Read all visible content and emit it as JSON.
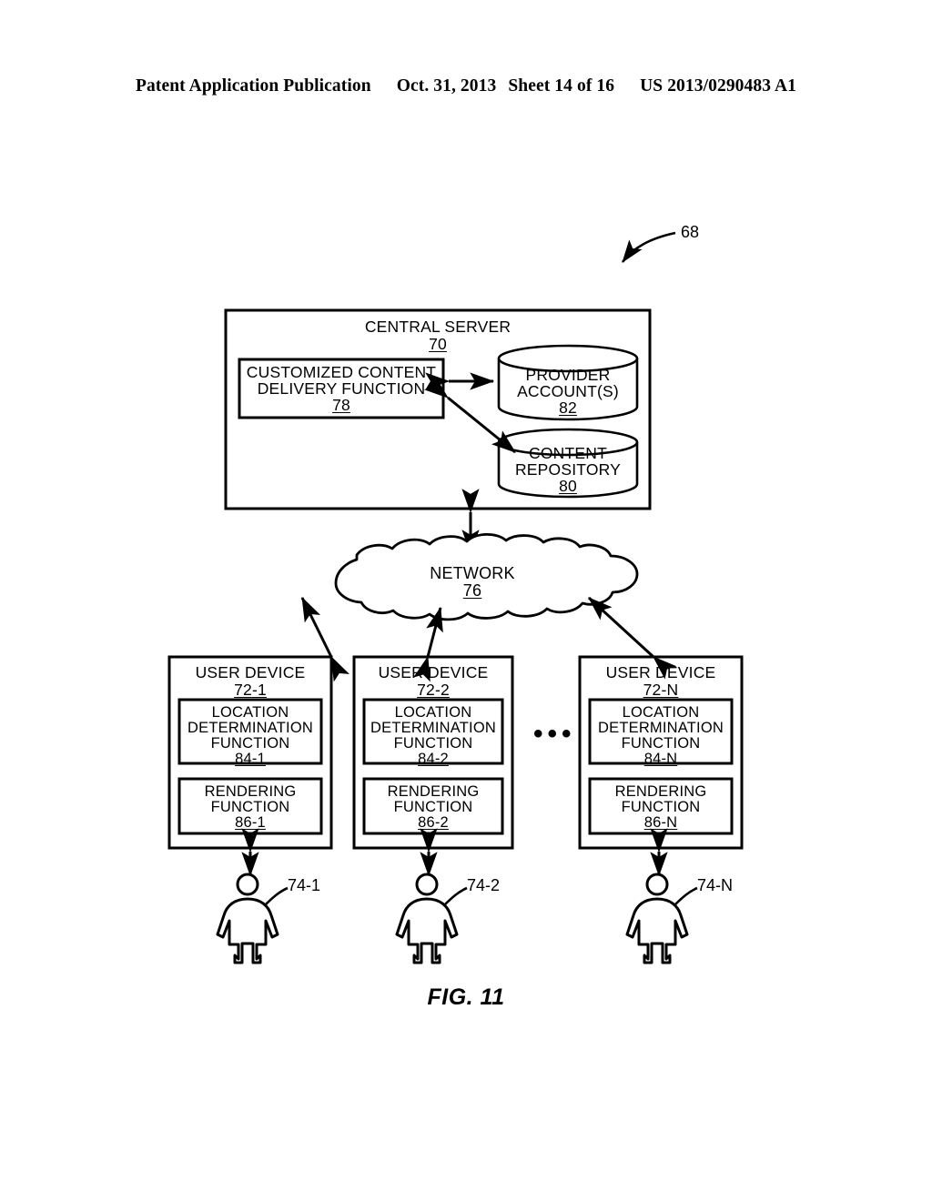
{
  "header": {
    "publication": "Patent Application Publication",
    "date": "Oct. 31, 2013",
    "sheet": "Sheet 14 of 16",
    "patent_number": "US 2013/0290483 A1"
  },
  "figure": {
    "caption": "FIG. 11",
    "system_ref": "68",
    "central_server": {
      "title": "CENTRAL SERVER",
      "ref": "70",
      "function_box": {
        "line1": "CUSTOMIZED CONTENT",
        "line2": "DELIVERY FUNCTION",
        "ref": "78"
      },
      "provider_account": {
        "line1": "PROVIDER",
        "line2": "ACCOUNT(S)",
        "ref": "82"
      },
      "content_repository": {
        "line1": "CONTENT",
        "line2": "REPOSITORY",
        "ref": "80"
      }
    },
    "network": {
      "title": "NETWORK",
      "ref": "76"
    },
    "user_devices": [
      {
        "title": "USER DEVICE",
        "ref": "72-1",
        "location_function": {
          "line1": "LOCATION",
          "line2": "DETERMINATION",
          "line3": "FUNCTION",
          "ref": "84-1"
        },
        "rendering_function": {
          "line1": "RENDERING",
          "line2": "FUNCTION",
          "ref": "86-1"
        },
        "user_ref": "74-1"
      },
      {
        "title": "USER DEVICE",
        "ref": "72-2",
        "location_function": {
          "line1": "LOCATION",
          "line2": "DETERMINATION",
          "line3": "FUNCTION",
          "ref": "84-2"
        },
        "rendering_function": {
          "line1": "RENDERING",
          "line2": "FUNCTION",
          "ref": "86-2"
        },
        "user_ref": "74-2"
      },
      {
        "title": "USER DEVICE",
        "ref": "72-N",
        "location_function": {
          "line1": "LOCATION",
          "line2": "DETERMINATION",
          "line3": "FUNCTION",
          "ref": "84-N"
        },
        "rendering_function": {
          "line1": "RENDERING",
          "line2": "FUNCTION",
          "ref": "86-N"
        },
        "user_ref": "74-N"
      }
    ],
    "ellipsis": "•••",
    "ink_color": "#000000"
  }
}
